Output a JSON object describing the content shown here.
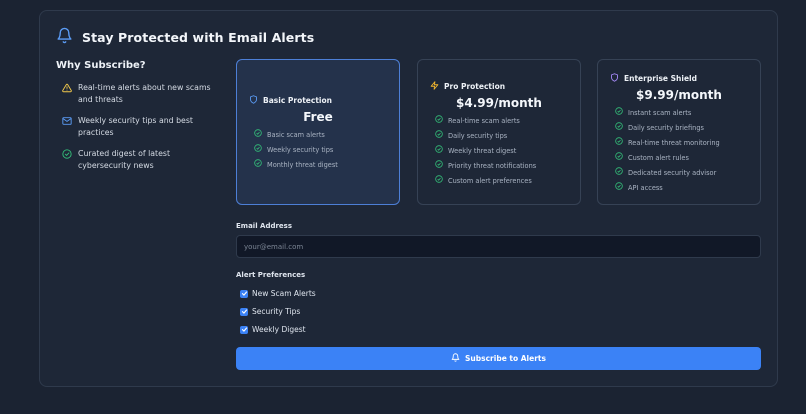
{
  "header": {
    "title": "Stay Protected with Email Alerts",
    "icon": "bell-icon"
  },
  "why": {
    "title": "Why Subscribe?",
    "items": [
      {
        "icon": "warning-icon",
        "text": "Real-time alerts about new scams and threats"
      },
      {
        "icon": "mail-icon",
        "text": "Weekly security tips and best practices"
      },
      {
        "icon": "check-circle-icon",
        "text": "Curated digest of latest cybersecurity news"
      }
    ]
  },
  "plans": [
    {
      "name": "Basic Protection",
      "price": "Free",
      "icon": "shield-icon",
      "selected": true,
      "features": [
        "Basic scam alerts",
        "Weekly security tips",
        "Monthly threat digest"
      ]
    },
    {
      "name": "Pro Protection",
      "price": "$4.99/month",
      "icon": "lightning-icon",
      "selected": false,
      "features": [
        "Real-time scam alerts",
        "Daily security tips",
        "Weekly threat digest",
        "Priority threat notifications",
        "Custom alert preferences"
      ]
    },
    {
      "name": "Enterprise Shield",
      "price": "$9.99/month",
      "icon": "shield-icon",
      "selected": false,
      "features": [
        "Instant scam alerts",
        "Daily security briefings",
        "Real-time threat monitoring",
        "Custom alert rules",
        "Dedicated security advisor",
        "API access"
      ]
    }
  ],
  "form": {
    "email_label": "Email Address",
    "email_placeholder": "your@email.com",
    "email_value": "",
    "prefs_label": "Alert Preferences",
    "prefs": [
      {
        "label": "New Scam Alerts",
        "checked": true
      },
      {
        "label": "Security Tips",
        "checked": true
      },
      {
        "label": "Weekly Digest",
        "checked": true
      }
    ],
    "submit_label": "Subscribe to Alerts"
  },
  "colors": {
    "background": "#1b2332",
    "accent": "#3b82f6",
    "check_green": "#34c07a",
    "warning_yellow": "#f2c94c",
    "lightning_yellow": "#f5b82e",
    "enterprise_purple": "#a78bfa"
  }
}
